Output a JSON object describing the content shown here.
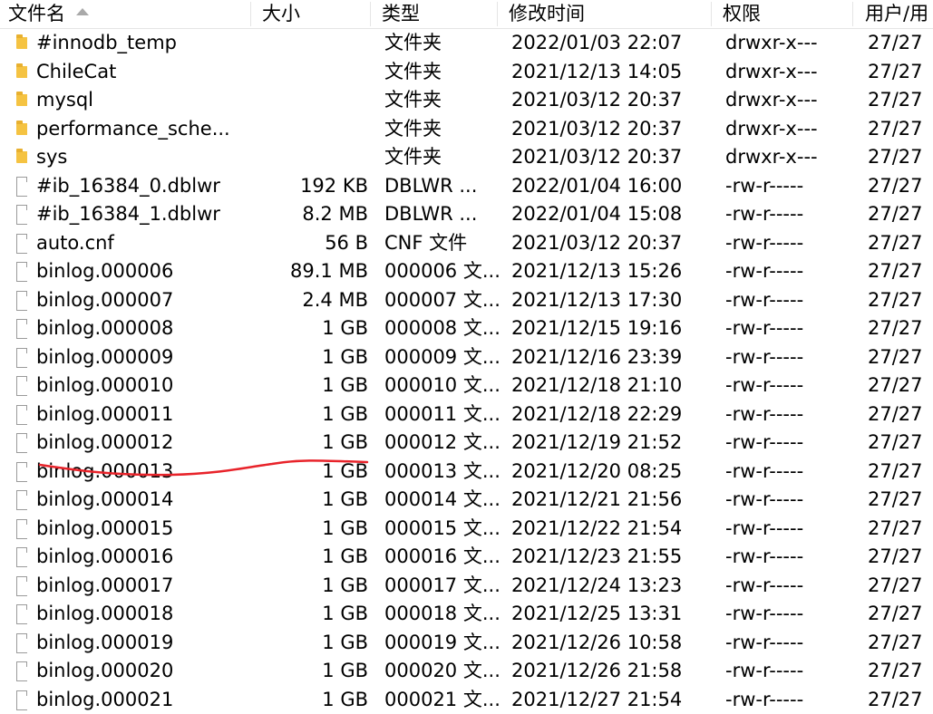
{
  "columns": {
    "name": "文件名",
    "size": "大小",
    "type": "类型",
    "modified": "修改时间",
    "permissions": "权限",
    "owner": "用户/用"
  },
  "sort": {
    "column": "name",
    "direction": "ascending",
    "indicator_icon": "sort-ascending-icon"
  },
  "files": [
    {
      "icon": "folder-icon",
      "name": "#innodb_temp",
      "size": "",
      "type": "文件夹",
      "modified": "2022/01/03 22:07",
      "permissions": "drwxr-x---",
      "owner": "27/27"
    },
    {
      "icon": "folder-icon",
      "name": "ChileCat",
      "size": "",
      "type": "文件夹",
      "modified": "2021/12/13 14:05",
      "permissions": "drwxr-x---",
      "owner": "27/27"
    },
    {
      "icon": "folder-icon",
      "name": "mysql",
      "size": "",
      "type": "文件夹",
      "modified": "2021/03/12 20:37",
      "permissions": "drwxr-x---",
      "owner": "27/27"
    },
    {
      "icon": "folder-icon",
      "name": "performance_sche...",
      "size": "",
      "type": "文件夹",
      "modified": "2021/03/12 20:37",
      "permissions": "drwxr-x---",
      "owner": "27/27"
    },
    {
      "icon": "folder-icon",
      "name": "sys",
      "size": "",
      "type": "文件夹",
      "modified": "2021/03/12 20:37",
      "permissions": "drwxr-x---",
      "owner": "27/27"
    },
    {
      "icon": "file-icon",
      "name": "#ib_16384_0.dblwr",
      "size": "192 KB",
      "type": "DBLWR ...",
      "modified": "2022/01/04 16:00",
      "permissions": "-rw-r-----",
      "owner": "27/27"
    },
    {
      "icon": "file-icon",
      "name": "#ib_16384_1.dblwr",
      "size": "8.2 MB",
      "type": "DBLWR ...",
      "modified": "2022/01/04 15:08",
      "permissions": "-rw-r-----",
      "owner": "27/27"
    },
    {
      "icon": "file-icon",
      "name": "auto.cnf",
      "size": "56 B",
      "type": "CNF 文件",
      "modified": "2021/03/12 20:37",
      "permissions": "-rw-r-----",
      "owner": "27/27"
    },
    {
      "icon": "file-icon",
      "name": "binlog.000006",
      "size": "89.1 MB",
      "type": "000006 文...",
      "modified": "2021/12/13 15:26",
      "permissions": "-rw-r-----",
      "owner": "27/27"
    },
    {
      "icon": "file-icon",
      "name": "binlog.000007",
      "size": "2.4 MB",
      "type": "000007 文...",
      "modified": "2021/12/13 17:30",
      "permissions": "-rw-r-----",
      "owner": "27/27"
    },
    {
      "icon": "file-icon",
      "name": "binlog.000008",
      "size": "1 GB",
      "type": "000008 文...",
      "modified": "2021/12/15 19:16",
      "permissions": "-rw-r-----",
      "owner": "27/27"
    },
    {
      "icon": "file-icon",
      "name": "binlog.000009",
      "size": "1 GB",
      "type": "000009 文...",
      "modified": "2021/12/16 23:39",
      "permissions": "-rw-r-----",
      "owner": "27/27"
    },
    {
      "icon": "file-icon",
      "name": "binlog.000010",
      "size": "1 GB",
      "type": "000010 文...",
      "modified": "2021/12/18 21:10",
      "permissions": "-rw-r-----",
      "owner": "27/27"
    },
    {
      "icon": "file-icon",
      "name": "binlog.000011",
      "size": "1 GB",
      "type": "000011 文...",
      "modified": "2021/12/18 22:29",
      "permissions": "-rw-r-----",
      "owner": "27/27"
    },
    {
      "icon": "file-icon",
      "name": "binlog.000012",
      "size": "1 GB",
      "type": "000012 文...",
      "modified": "2021/12/19 21:52",
      "permissions": "-rw-r-----",
      "owner": "27/27"
    },
    {
      "icon": "file-icon",
      "name": "binlog.000013",
      "size": "1 GB",
      "type": "000013 文...",
      "modified": "2021/12/20 08:25",
      "permissions": "-rw-r-----",
      "owner": "27/27"
    },
    {
      "icon": "file-icon",
      "name": "binlog.000014",
      "size": "1 GB",
      "type": "000014 文...",
      "modified": "2021/12/21 21:56",
      "permissions": "-rw-r-----",
      "owner": "27/27"
    },
    {
      "icon": "file-icon",
      "name": "binlog.000015",
      "size": "1 GB",
      "type": "000015 文...",
      "modified": "2021/12/22 21:54",
      "permissions": "-rw-r-----",
      "owner": "27/27"
    },
    {
      "icon": "file-icon",
      "name": "binlog.000016",
      "size": "1 GB",
      "type": "000016 文...",
      "modified": "2021/12/23 21:55",
      "permissions": "-rw-r-----",
      "owner": "27/27"
    },
    {
      "icon": "file-icon",
      "name": "binlog.000017",
      "size": "1 GB",
      "type": "000017 文...",
      "modified": "2021/12/24 13:23",
      "permissions": "-rw-r-----",
      "owner": "27/27"
    },
    {
      "icon": "file-icon",
      "name": "binlog.000018",
      "size": "1 GB",
      "type": "000018 文...",
      "modified": "2021/12/25 13:31",
      "permissions": "-rw-r-----",
      "owner": "27/27"
    },
    {
      "icon": "file-icon",
      "name": "binlog.000019",
      "size": "1 GB",
      "type": "000019 文...",
      "modified": "2021/12/26 10:58",
      "permissions": "-rw-r-----",
      "owner": "27/27"
    },
    {
      "icon": "file-icon",
      "name": "binlog.000020",
      "size": "1 GB",
      "type": "000020 文...",
      "modified": "2021/12/26 21:58",
      "permissions": "-rw-r-----",
      "owner": "27/27"
    },
    {
      "icon": "file-icon",
      "name": "binlog.000021",
      "size": "1 GB",
      "type": "000021 文...",
      "modified": "2021/12/27 21:54",
      "permissions": "-rw-r-----",
      "owner": "27/27"
    }
  ],
  "annotation": {
    "color": "#e8232a"
  }
}
